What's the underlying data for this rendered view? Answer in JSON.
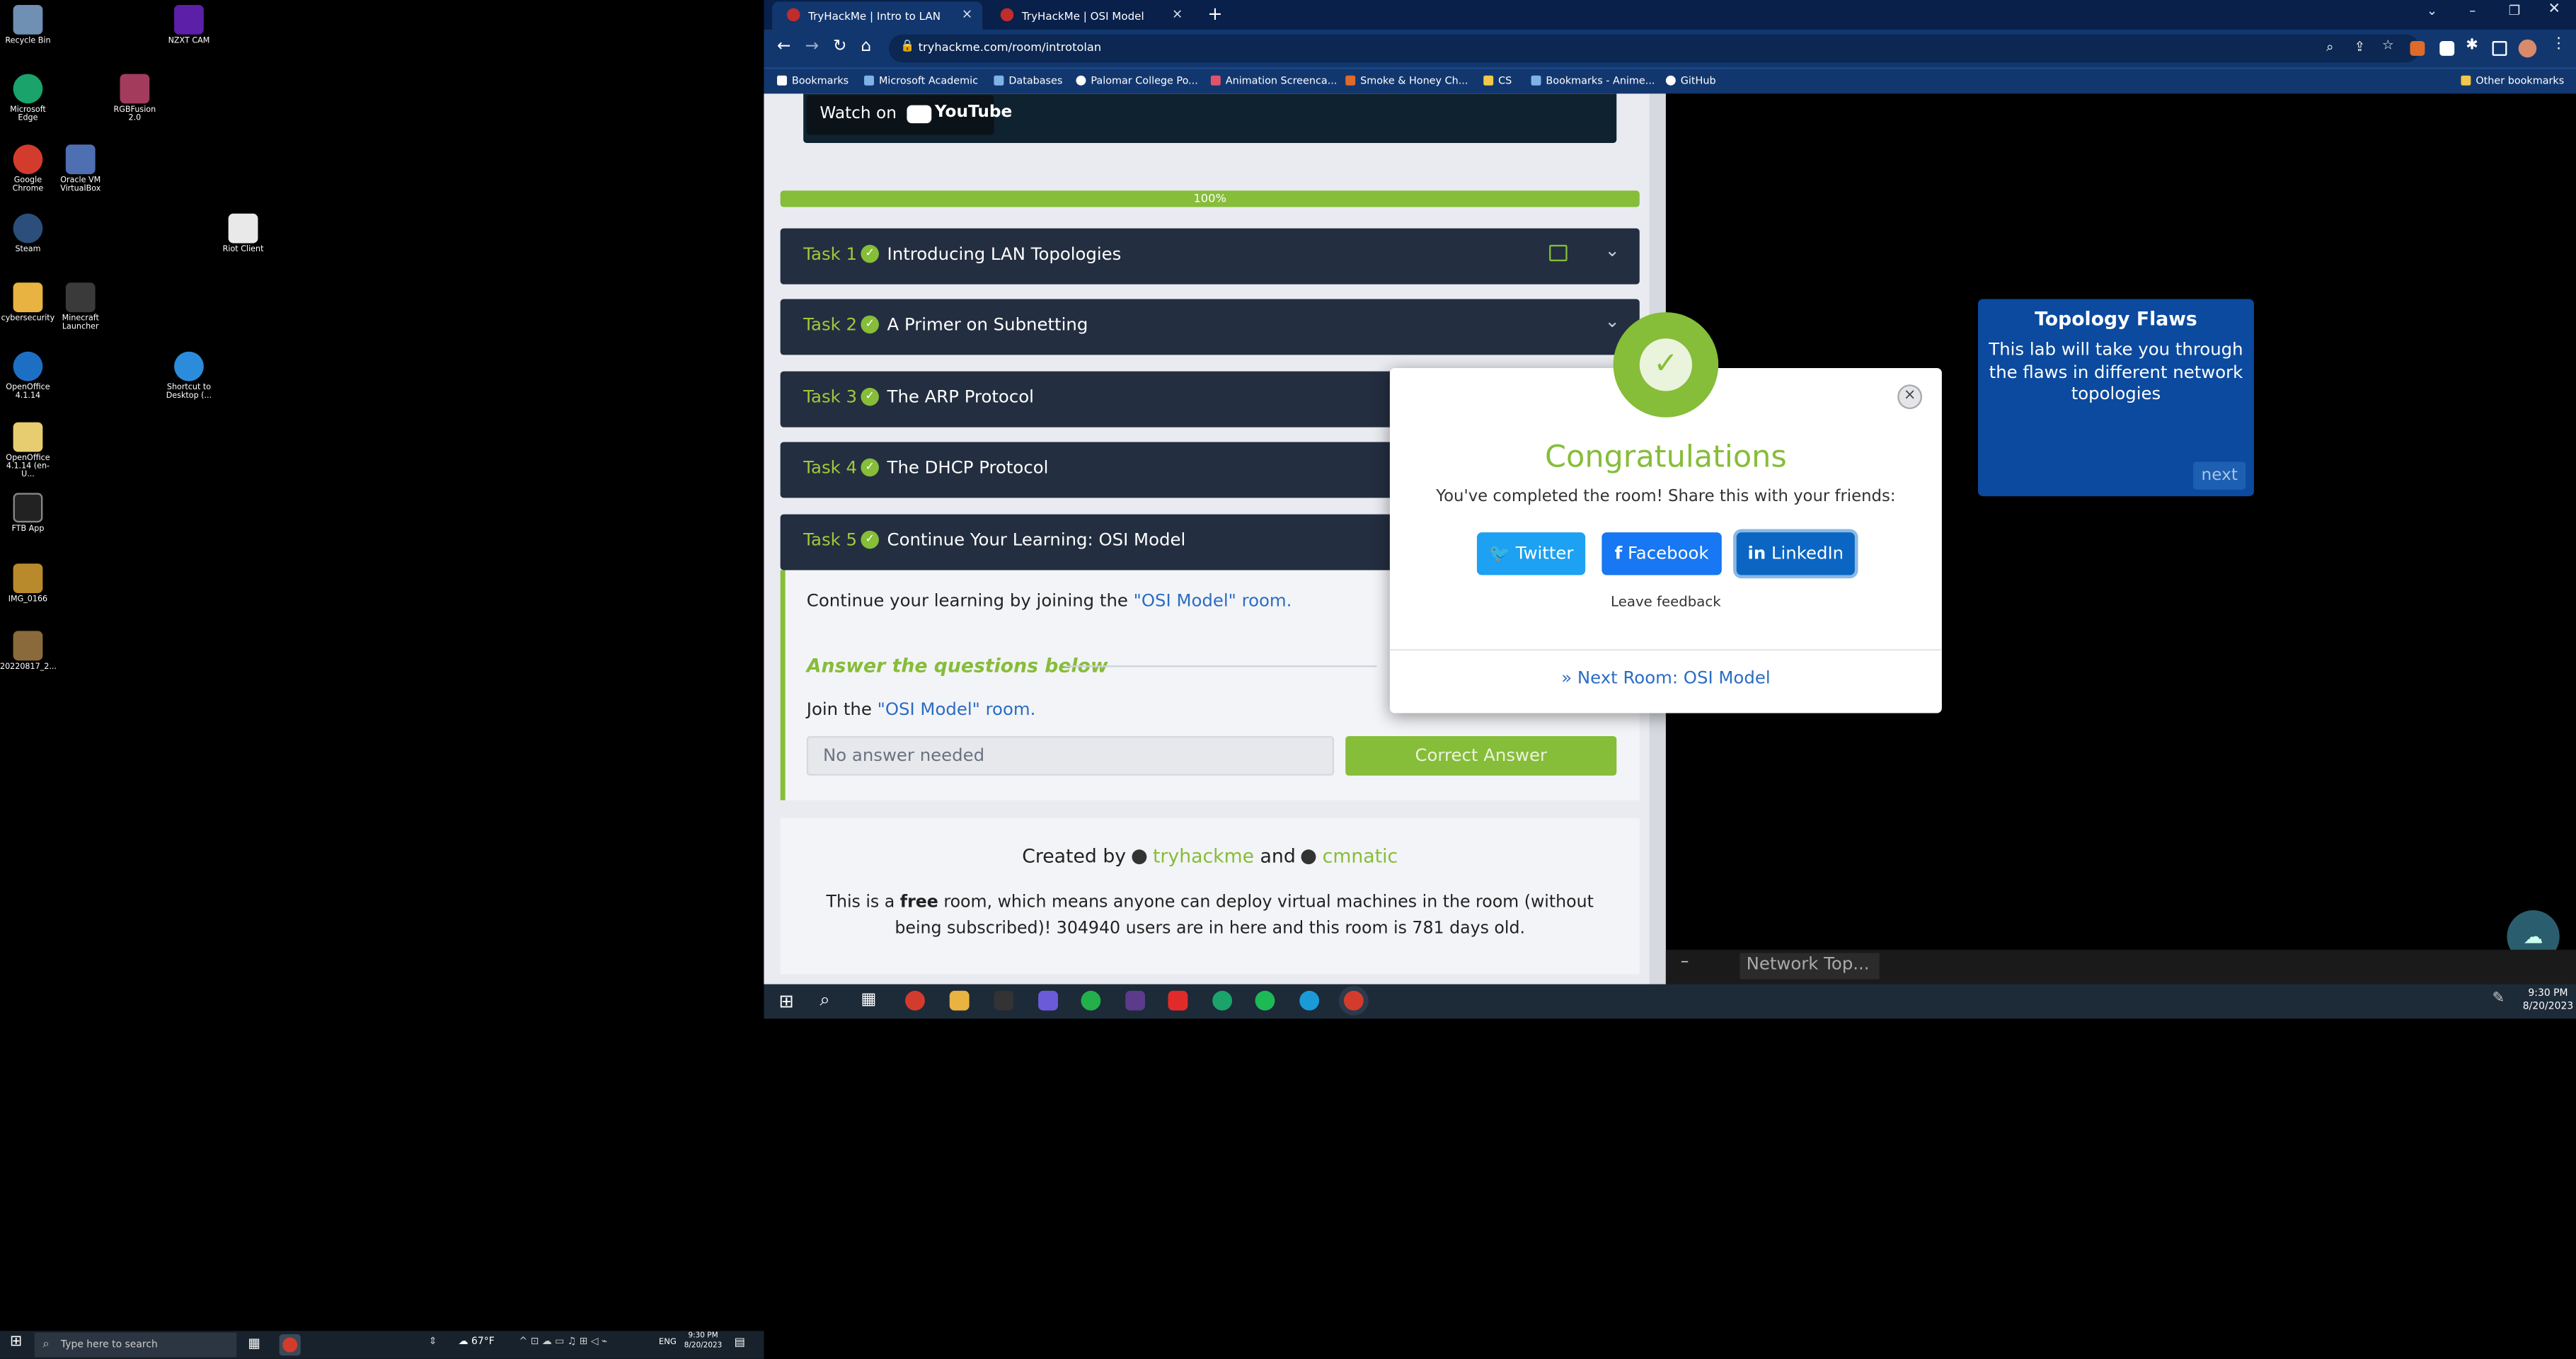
{
  "desktop": {
    "icons": [
      {
        "label": "Recycle Bin",
        "icon": "recycle-bin-icon",
        "color": "#6f8fb3"
      },
      {
        "label": "NZXT CAM",
        "icon": "nzxt-cam-icon",
        "color": "#5b1fa8"
      },
      {
        "label": "Microsoft Edge",
        "icon": "edge-icon",
        "color": "#1aa36b"
      },
      {
        "label": "RGBFusion 2.0",
        "icon": "rgbfusion-icon",
        "color": "#a33b5c"
      },
      {
        "label": "Google Chrome",
        "icon": "chrome-icon",
        "color": "#d33c2c"
      },
      {
        "label": "Oracle VM VirtualBox",
        "icon": "virtualbox-icon",
        "color": "#4f6fb3"
      },
      {
        "label": "Riot Client",
        "icon": "file-icon",
        "color": "#e9e9e9"
      },
      {
        "label": "Steam",
        "icon": "steam-icon",
        "color": "#2b4f7a"
      },
      {
        "label": "cybersecurity",
        "icon": "folder-icon",
        "color": "#e8b340"
      },
      {
        "label": "Minecraft Launcher",
        "icon": "minecraft-icon",
        "color": "#3a3a3a"
      },
      {
        "label": "OpenOffice 4.1.14",
        "icon": "openoffice-icon",
        "color": "#1d6fc4"
      },
      {
        "label": "Shortcut to Desktop (...",
        "icon": "onedrive-icon",
        "color": "#2b8cdb"
      },
      {
        "label": "OpenOffice 4.1.14 (en-U...",
        "icon": "folder-icon",
        "color": "#e8cc70"
      },
      {
        "label": "FTB App",
        "icon": "ftb-app-icon",
        "color": "#222"
      },
      {
        "label": "IMG_0166",
        "icon": "image-icon",
        "color": "#b98a2c"
      },
      {
        "label": "20220817_2...",
        "icon": "image-icon",
        "color": "#8a6a3a"
      }
    ]
  },
  "browser": {
    "tabs": [
      {
        "label": "TryHackMe | Intro to LAN"
      },
      {
        "label": "TryHackMe | OSI Model"
      }
    ],
    "url": "tryhackme.com/room/introtolan",
    "bookmarks": [
      {
        "label": "Bookmarks",
        "color": "#ffffff"
      },
      {
        "label": "Microsoft Academic",
        "color": "#7fb3e8"
      },
      {
        "label": "Databases",
        "color": "#7fb3e8"
      },
      {
        "label": "Palomar College Po...",
        "color": "#ffffff"
      },
      {
        "label": "Animation Screenca...",
        "color": "#e0536b"
      },
      {
        "label": "Smoke & Honey Ch...",
        "color": "#e06a2b"
      },
      {
        "label": "CS",
        "color": "#f0c84a"
      },
      {
        "label": "Bookmarks - Anime...",
        "color": "#7fb3e8"
      },
      {
        "label": "GitHub",
        "color": "#ffffff"
      }
    ],
    "other_bookmarks": "Other bookmarks"
  },
  "page": {
    "watch_on": "Watch on",
    "youtube": "YouTube",
    "progress_label": "100%",
    "progress_value": 100,
    "tasks": [
      {
        "num": "Task 1",
        "title": "Introducing LAN Topologies"
      },
      {
        "num": "Task 2",
        "title": "A Primer on Subnetting"
      },
      {
        "num": "Task 3",
        "title": "The ARP Protocol"
      },
      {
        "num": "Task 4",
        "title": "The DHCP Protocol"
      },
      {
        "num": "Task 5",
        "title": "Continue Your Learning: OSI Model"
      }
    ],
    "continue_text": "Continue your learning by joining the ",
    "osi_link": "\"OSI Model\" room.",
    "answer_heading": "Answer the questions below",
    "join_text": "Join the ",
    "join_link": "\"OSI Model\" room.",
    "answer_placeholder": "No answer needed",
    "correct_answer": "Correct Answer",
    "created_by": "Created by",
    "author1": "tryhackme",
    "and": "and",
    "author2": "cmnatic",
    "footer_a": "This is a ",
    "footer_free": "free",
    "footer_b": " room, which means anyone can deploy virtual machines in the room (without being subscribed)! 304940 users are in here and this room is 781 days old."
  },
  "lab": {
    "card_title": "Topology Flaws",
    "card_text": "This lab will take you through the flaws in different network topologies",
    "next": "next",
    "footer_label": "Network Top..."
  },
  "modal": {
    "title": "Congratulations",
    "subtitle": "You've completed the room! Share this with your friends:",
    "twitter": "Twitter",
    "facebook": "Facebook",
    "linkedin": "LinkedIn",
    "feedback": "Leave feedback",
    "next_room": "Next Room: OSI Model"
  },
  "taskbar_inner": {
    "time": "9:30 PM",
    "date": "8/20/2023"
  },
  "taskbar_main": {
    "search": "Type here to search",
    "weather": "67°F",
    "lang": "ENG",
    "time": "9:30 PM",
    "date": "8/20/2023"
  },
  "colors": {
    "green": "#86bd39",
    "task_bg": "#232e40",
    "twitter": "#1da1f2",
    "facebook": "#1877f2",
    "linkedin": "#0a66c2",
    "link": "#2b6cc4"
  }
}
